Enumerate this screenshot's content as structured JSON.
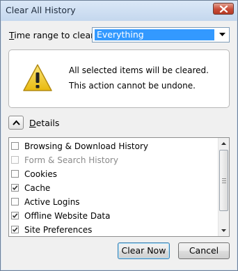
{
  "window": {
    "title": "Clear All History"
  },
  "time_range": {
    "label_prefix": "",
    "label_accesskey": "T",
    "label_rest": "ime range to clear:",
    "selected": "Everything"
  },
  "warning": {
    "line1": "All selected items will be cleared.",
    "line2": "This action cannot be undone."
  },
  "details": {
    "label_accesskey": "D",
    "label_rest": "etails",
    "expanded": true
  },
  "items": [
    {
      "label": "Browsing & Download History",
      "checked": false,
      "enabled": true
    },
    {
      "label": "Form & Search History",
      "checked": false,
      "enabled": false
    },
    {
      "label": "Cookies",
      "checked": false,
      "enabled": true
    },
    {
      "label": "Cache",
      "checked": true,
      "enabled": true
    },
    {
      "label": "Active Logins",
      "checked": false,
      "enabled": true
    },
    {
      "label": "Offline Website Data",
      "checked": true,
      "enabled": true
    },
    {
      "label": "Site Preferences",
      "checked": true,
      "enabled": true
    }
  ],
  "buttons": {
    "clear_now": "Clear Now",
    "cancel": "Cancel"
  },
  "colors": {
    "selection": "#3399ff",
    "titlebar": "#c4d7ee",
    "close": "#c94b37",
    "warning_yellow": "#f5d12a"
  },
  "icons": {
    "close": "close-icon",
    "dropdown": "chevron-down-icon",
    "warning": "warning-icon",
    "collapse": "chevron-up-icon"
  }
}
